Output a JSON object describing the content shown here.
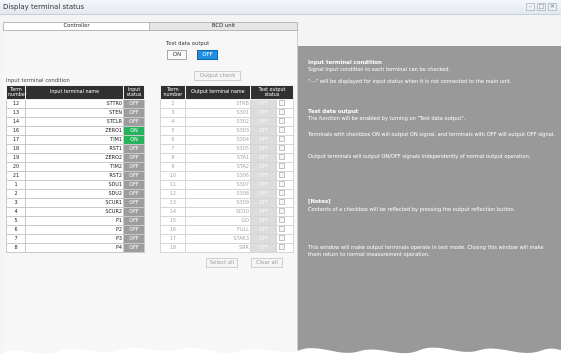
{
  "window": {
    "title": "Display terminal status",
    "controls": [
      "–",
      "□",
      "✕"
    ]
  },
  "tabs": [
    {
      "label": "Controller",
      "active": true
    },
    {
      "label": "BCD unit",
      "active": false
    }
  ],
  "test_output": {
    "label": "Test data output",
    "on_label": "ON",
    "off_label": "OFF",
    "selected": "OFF",
    "output_check_label": "Output check",
    "select_all_label": "Select all",
    "clear_all_label": "Clear all"
  },
  "input_table": {
    "caption": "Input terminal condition",
    "headers": {
      "term": "Term number",
      "name": "Input terminal name",
      "status": "Input status"
    },
    "rows": [
      {
        "term": "12",
        "name": "STTR0",
        "status": "OFF"
      },
      {
        "term": "13",
        "name": "STEN",
        "status": "OFF"
      },
      {
        "term": "14",
        "name": "STCLR",
        "status": "OFF"
      },
      {
        "term": "16",
        "name": "ZERO1",
        "status": "ON"
      },
      {
        "term": "17",
        "name": "TIM1",
        "status": "ON"
      },
      {
        "term": "18",
        "name": "RST1",
        "status": "OFF"
      },
      {
        "term": "19",
        "name": "ZERO2",
        "status": "OFF"
      },
      {
        "term": "20",
        "name": "TIM2",
        "status": "OFF"
      },
      {
        "term": "21",
        "name": "RST2",
        "status": "OFF"
      },
      {
        "term": "1",
        "name": "SDU1",
        "status": "OFF"
      },
      {
        "term": "2",
        "name": "SDU2",
        "status": "OFF"
      },
      {
        "term": "3",
        "name": "SCUR1",
        "status": "OFF"
      },
      {
        "term": "4",
        "name": "SCUR2",
        "status": "OFF"
      },
      {
        "term": "5",
        "name": "P1",
        "status": "OFF"
      },
      {
        "term": "6",
        "name": "P2",
        "status": "OFF"
      },
      {
        "term": "7",
        "name": "P3",
        "status": "OFF"
      },
      {
        "term": "8",
        "name": "P4",
        "status": "OFF"
      }
    ]
  },
  "output_table": {
    "headers": {
      "term": "Term number",
      "name": "Output terminal name",
      "status": "Test output status"
    },
    "rows": [
      {
        "term": "2",
        "name": "STRB",
        "status": "OFF"
      },
      {
        "term": "3",
        "name": "S301",
        "status": "OFF"
      },
      {
        "term": "4",
        "name": "S302",
        "status": "OFF"
      },
      {
        "term": "5",
        "name": "S303",
        "status": "OFF"
      },
      {
        "term": "6",
        "name": "S304",
        "status": "OFF"
      },
      {
        "term": "7",
        "name": "S305",
        "status": "OFF"
      },
      {
        "term": "8",
        "name": "STA1",
        "status": "OFF"
      },
      {
        "term": "9",
        "name": "STA2",
        "status": "OFF"
      },
      {
        "term": "10",
        "name": "S306",
        "status": "OFF"
      },
      {
        "term": "11",
        "name": "S307",
        "status": "OFF"
      },
      {
        "term": "12",
        "name": "S308",
        "status": "OFF"
      },
      {
        "term": "13",
        "name": "S309",
        "status": "OFF"
      },
      {
        "term": "14",
        "name": "SD10",
        "status": "OFF"
      },
      {
        "term": "15",
        "name": "GO",
        "status": "OFF"
      },
      {
        "term": "16",
        "name": "FULL",
        "status": "OFF"
      },
      {
        "term": "17",
        "name": "STAR3",
        "status": "OFF"
      },
      {
        "term": "18",
        "name": "SRR",
        "status": "OFF"
      }
    ]
  },
  "help": {
    "input_heading": "Input terminal condition",
    "input_text1": "Signal input condition to each terminal can be checked.",
    "input_text2": "\"---\" will be displayed for input status when it is not connected to the main unit.",
    "test_heading": "Test data output",
    "test_text1": "The function will be enabled by turning on \"Test data output\".",
    "test_text2": "Terminals with checkbox ON will output ON signal, and terminals with OFF will output OFF signal.",
    "test_text3": "Output terminals will output ON/OFF signals independently of normal output operation.",
    "notes_heading": "[Notes]",
    "notes_text1": "Contents of a checkbox will be reflected by pressing the output reflection button.",
    "notes_text2": "This window will make output terminals operate in test mode. Closing this window will make them return to normal measurement operation."
  },
  "colors": {
    "on_status": "#25b35b",
    "off_status": "#9d9d9d",
    "header_bg": "#303030",
    "help_panel": "#999999",
    "selected_button": "#1e8fe0"
  }
}
